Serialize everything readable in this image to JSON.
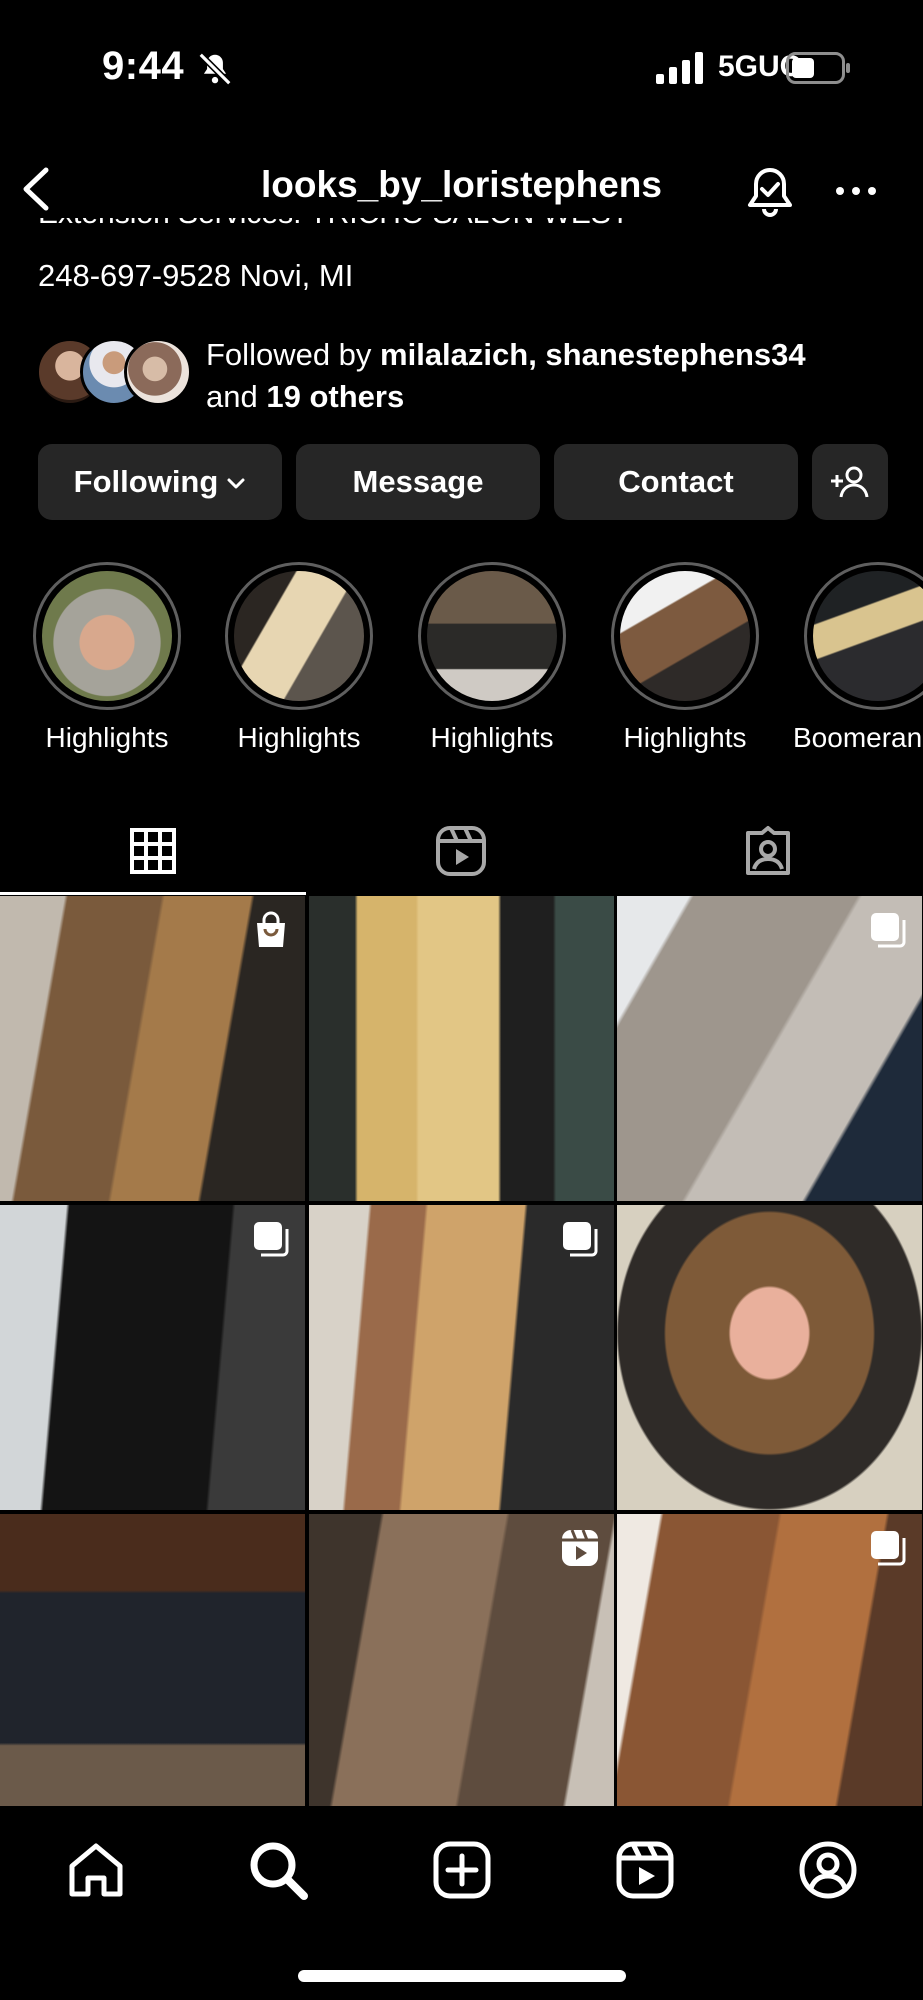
{
  "status_bar": {
    "time": "9:44",
    "network": "5GUC",
    "icons": [
      "bell-slash-icon",
      "signal-icon",
      "battery-icon"
    ]
  },
  "header": {
    "username": "looks_by_loristephens",
    "icons": [
      "back-icon",
      "notification-bell-icon",
      "more-icon"
    ]
  },
  "bio": {
    "cut_line": "Extension Services: TRICHO SALON WEST",
    "phone_location": "248-697-9528 Novi, MI"
  },
  "followed_by": {
    "prefix": "Followed by ",
    "names": "milalazich, shanestephens34",
    "and": "and ",
    "others": "19 others"
  },
  "actions": {
    "following": "Following",
    "message": "Message",
    "contact": "Contact"
  },
  "highlights": [
    {
      "label": "Highlights"
    },
    {
      "label": "Highlights"
    },
    {
      "label": "Highlights"
    },
    {
      "label": "Highlights"
    },
    {
      "label": "Boomerang"
    }
  ],
  "tabs": [
    "grid-icon",
    "reels-icon",
    "tagged-icon"
  ],
  "posts": [
    {
      "type": "shopping"
    },
    {
      "type": "photo"
    },
    {
      "type": "carousel"
    },
    {
      "type": "carousel"
    },
    {
      "type": "carousel"
    },
    {
      "type": "photo"
    },
    {
      "type": "photo"
    },
    {
      "type": "reel"
    },
    {
      "type": "carousel"
    }
  ],
  "bottom_nav": [
    "home-icon",
    "search-icon",
    "create-icon",
    "reels-icon",
    "profile-icon"
  ],
  "colors": {
    "background": "#000000",
    "button": "#262626",
    "text": "#ffffff",
    "ring": "#5f5f5f"
  }
}
